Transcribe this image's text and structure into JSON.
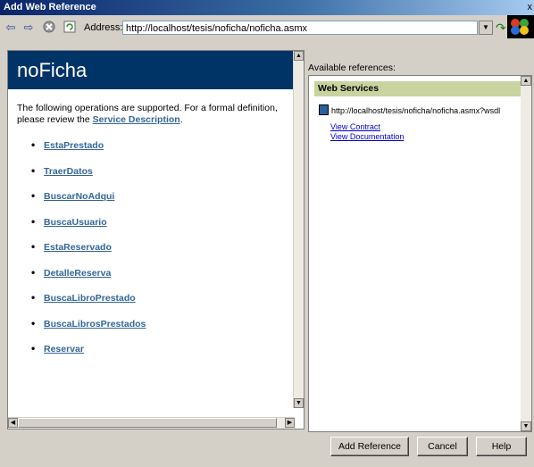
{
  "window": {
    "title": "Add Web Reference",
    "close_glyph": "x"
  },
  "toolbar": {
    "back_icon": "back-arrow-icon",
    "forward_icon": "forward-arrow-icon",
    "stop_icon": "stop-icon",
    "refresh_icon": "refresh-icon",
    "address_label": "Address:",
    "address_value": "http://localhost/tesis/noficha/noficha.asmx",
    "go_icon": "go-arrow-icon"
  },
  "service": {
    "name": "noFicha",
    "intro_prefix": "The following operations are supported. For a formal definition, please review the ",
    "description_link": "Service Description",
    "intro_suffix": ".",
    "operations": [
      "EstaPrestado",
      "TraerDatos",
      "BuscarNoAdqui",
      "BuscaUsuario",
      "EstaReservado",
      "DetalleReserva",
      "BuscaLibroPrestado",
      "BuscaLibrosPrestados",
      "Reservar"
    ]
  },
  "references": {
    "label": "Available references:",
    "header": "Web Services",
    "url": "http://localhost/tesis/noficha/noficha.asmx?wsdl",
    "view_contract": "View Contract",
    "view_documentation": "View Documentation"
  },
  "buttons": {
    "add_reference": "Add Reference",
    "cancel": "Cancel",
    "help": "Help"
  }
}
